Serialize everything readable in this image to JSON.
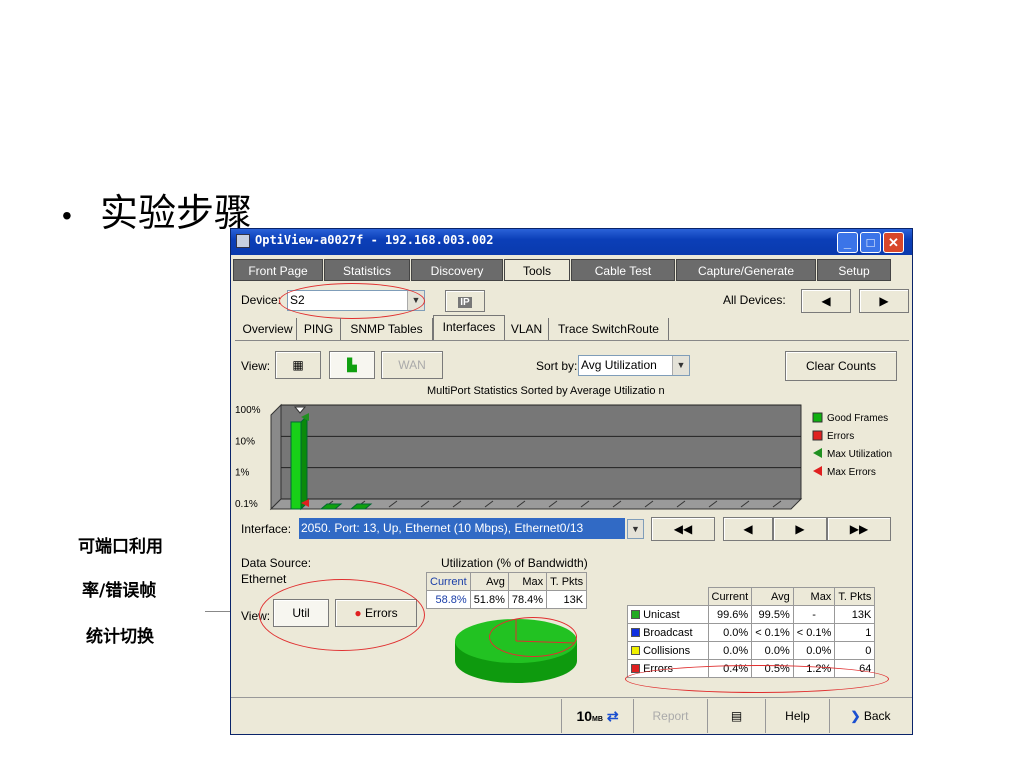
{
  "slide": {
    "bullet": "•",
    "heading": "实验步骤",
    "side_note": [
      "可端口利用",
      "率/错误帧",
      "统计切换"
    ]
  },
  "window": {
    "title": "OptiView-a0027f - 192.168.003.002",
    "tabs": [
      "Front Page",
      "Statistics",
      "Discovery",
      "Tools",
      "Cable Test",
      "Capture/Generate",
      "Setup"
    ],
    "active_tab": "Tools",
    "device_label": "Device:",
    "device_value": "S2",
    "ip_button": "IP",
    "all_devices_label": "All Devices:",
    "subtabs": [
      "Overview",
      "PING",
      "SNMP Tables",
      "Interfaces",
      "VLAN",
      "Trace SwitchRoute"
    ],
    "active_subtab": "Interfaces",
    "view_label": "View:",
    "wan_button": "WAN",
    "sort_label": "Sort by:",
    "sort_value": "Avg Utilization",
    "clear_counts": "Clear Counts",
    "interface_label": "Interface:",
    "interface_value": "2050. Port: 13, Up, Ethernet (10 Mbps), Ethernet0/13",
    "data_source_label": "Data Source:",
    "data_source_value": "Ethernet",
    "util_title": "Utilization (% of Bandwidth)",
    "util_headers": [
      "Current",
      "Avg",
      "Max",
      "T. Pkts"
    ],
    "util_values": [
      "58.8%",
      "51.8%",
      "78.4%",
      "13K"
    ],
    "view2_label": "View:",
    "util_button": "Util",
    "errors_button": "Errors",
    "frames_headers": [
      "Current",
      "Avg",
      "Max",
      "T. Pkts"
    ],
    "frames_rows": [
      {
        "name": "Unicast",
        "color": "#22aa22",
        "values": [
          "99.6%",
          "99.5%",
          "-",
          "13K"
        ]
      },
      {
        "name": "Broadcast",
        "color": "#1030e0",
        "values": [
          "0.0%",
          "< 0.1%",
          "< 0.1%",
          "1"
        ]
      },
      {
        "name": "Collisions",
        "color": "#f0f000",
        "values": [
          "0.0%",
          "0.0%",
          "0.0%",
          "0"
        ]
      },
      {
        "name": "Errors",
        "color": "#e02020",
        "values": [
          "0.4%",
          "0.5%",
          "1.2%",
          "64"
        ]
      }
    ],
    "status": {
      "speed": "10",
      "speed_unit": "MB",
      "report": "Report",
      "help": "Help",
      "back": "Back"
    }
  },
  "chart_data": {
    "type": "bar",
    "title": "MultiPort Statistics Sorted by Average Utilizatio n",
    "y_scale": "log",
    "y_ticks": [
      "100%",
      "10%",
      "1%",
      "0.1%"
    ],
    "ylim": [
      0.1,
      100
    ],
    "legend": [
      "Good Frames",
      "Errors",
      "Max Utilization",
      "Max Errors"
    ],
    "legend_colors": [
      "#10b010",
      "#e02020",
      "#209020",
      "#e02020"
    ],
    "legend_position": "right",
    "series": [
      {
        "name": "Good Frames",
        "values": [
          60,
          0.1,
          0.1
        ]
      }
    ]
  }
}
